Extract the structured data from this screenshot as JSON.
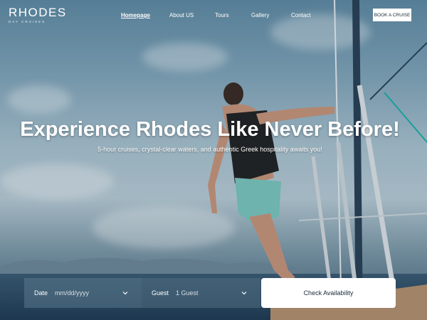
{
  "brand": {
    "name": "RHODES",
    "tagline": "DAY CRUISES"
  },
  "nav": {
    "items": [
      {
        "label": "Homepage",
        "active": true
      },
      {
        "label": "About US",
        "active": false
      },
      {
        "label": "Tours",
        "active": false
      },
      {
        "label": "Gallery",
        "active": false
      },
      {
        "label": "Contact",
        "active": false
      }
    ],
    "cta_label": "BOOK A CRUISE"
  },
  "hero": {
    "title": "Experience Rhodes Like Never Before!",
    "subtitle": "5-hour cruises, crystal-clear waters, and authentic Greek hospitality awaits you!"
  },
  "booking": {
    "date_label": "Date",
    "date_placeholder": "mm/dd/yyyy",
    "guest_label": "Guest",
    "guest_value": "1 Guest",
    "submit_label": "Check Availability"
  },
  "icons": {
    "date_dropdown": "chevron-down-icon",
    "guest_dropdown": "chevron-down-icon"
  },
  "colors": {
    "primary_text": "#ffffff",
    "button_bg": "#ffffff",
    "button_text": "#1a2a3a"
  }
}
